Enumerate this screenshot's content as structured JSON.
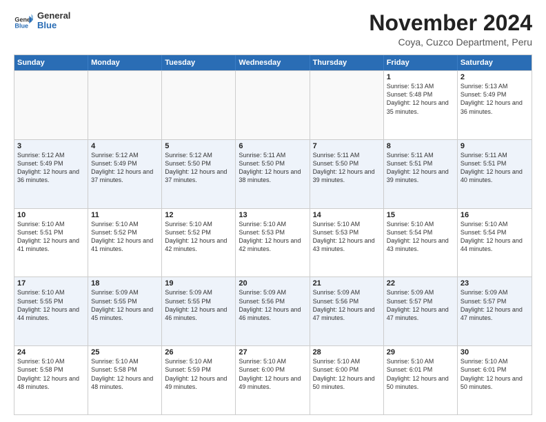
{
  "logo": {
    "general": "General",
    "blue": "Blue"
  },
  "header": {
    "month": "November 2024",
    "location": "Coya, Cuzco Department, Peru"
  },
  "days_of_week": [
    "Sunday",
    "Monday",
    "Tuesday",
    "Wednesday",
    "Thursday",
    "Friday",
    "Saturday"
  ],
  "weeks": [
    [
      {
        "day": "",
        "empty": true
      },
      {
        "day": "",
        "empty": true
      },
      {
        "day": "",
        "empty": true
      },
      {
        "day": "",
        "empty": true
      },
      {
        "day": "",
        "empty": true
      },
      {
        "day": "1",
        "sunrise": "5:13 AM",
        "sunset": "5:48 PM",
        "daylight": "12 hours and 35 minutes."
      },
      {
        "day": "2",
        "sunrise": "5:13 AM",
        "sunset": "5:49 PM",
        "daylight": "12 hours and 36 minutes."
      }
    ],
    [
      {
        "day": "3",
        "sunrise": "5:12 AM",
        "sunset": "5:49 PM",
        "daylight": "12 hours and 36 minutes."
      },
      {
        "day": "4",
        "sunrise": "5:12 AM",
        "sunset": "5:49 PM",
        "daylight": "12 hours and 37 minutes."
      },
      {
        "day": "5",
        "sunrise": "5:12 AM",
        "sunset": "5:50 PM",
        "daylight": "12 hours and 37 minutes."
      },
      {
        "day": "6",
        "sunrise": "5:11 AM",
        "sunset": "5:50 PM",
        "daylight": "12 hours and 38 minutes."
      },
      {
        "day": "7",
        "sunrise": "5:11 AM",
        "sunset": "5:50 PM",
        "daylight": "12 hours and 39 minutes."
      },
      {
        "day": "8",
        "sunrise": "5:11 AM",
        "sunset": "5:51 PM",
        "daylight": "12 hours and 39 minutes."
      },
      {
        "day": "9",
        "sunrise": "5:11 AM",
        "sunset": "5:51 PM",
        "daylight": "12 hours and 40 minutes."
      }
    ],
    [
      {
        "day": "10",
        "sunrise": "5:10 AM",
        "sunset": "5:51 PM",
        "daylight": "12 hours and 41 minutes."
      },
      {
        "day": "11",
        "sunrise": "5:10 AM",
        "sunset": "5:52 PM",
        "daylight": "12 hours and 41 minutes."
      },
      {
        "day": "12",
        "sunrise": "5:10 AM",
        "sunset": "5:52 PM",
        "daylight": "12 hours and 42 minutes."
      },
      {
        "day": "13",
        "sunrise": "5:10 AM",
        "sunset": "5:53 PM",
        "daylight": "12 hours and 42 minutes."
      },
      {
        "day": "14",
        "sunrise": "5:10 AM",
        "sunset": "5:53 PM",
        "daylight": "12 hours and 43 minutes."
      },
      {
        "day": "15",
        "sunrise": "5:10 AM",
        "sunset": "5:54 PM",
        "daylight": "12 hours and 43 minutes."
      },
      {
        "day": "16",
        "sunrise": "5:10 AM",
        "sunset": "5:54 PM",
        "daylight": "12 hours and 44 minutes."
      }
    ],
    [
      {
        "day": "17",
        "sunrise": "5:10 AM",
        "sunset": "5:55 PM",
        "daylight": "12 hours and 44 minutes."
      },
      {
        "day": "18",
        "sunrise": "5:09 AM",
        "sunset": "5:55 PM",
        "daylight": "12 hours and 45 minutes."
      },
      {
        "day": "19",
        "sunrise": "5:09 AM",
        "sunset": "5:55 PM",
        "daylight": "12 hours and 46 minutes."
      },
      {
        "day": "20",
        "sunrise": "5:09 AM",
        "sunset": "5:56 PM",
        "daylight": "12 hours and 46 minutes."
      },
      {
        "day": "21",
        "sunrise": "5:09 AM",
        "sunset": "5:56 PM",
        "daylight": "12 hours and 47 minutes."
      },
      {
        "day": "22",
        "sunrise": "5:09 AM",
        "sunset": "5:57 PM",
        "daylight": "12 hours and 47 minutes."
      },
      {
        "day": "23",
        "sunrise": "5:09 AM",
        "sunset": "5:57 PM",
        "daylight": "12 hours and 47 minutes."
      }
    ],
    [
      {
        "day": "24",
        "sunrise": "5:10 AM",
        "sunset": "5:58 PM",
        "daylight": "12 hours and 48 minutes."
      },
      {
        "day": "25",
        "sunrise": "5:10 AM",
        "sunset": "5:58 PM",
        "daylight": "12 hours and 48 minutes."
      },
      {
        "day": "26",
        "sunrise": "5:10 AM",
        "sunset": "5:59 PM",
        "daylight": "12 hours and 49 minutes."
      },
      {
        "day": "27",
        "sunrise": "5:10 AM",
        "sunset": "6:00 PM",
        "daylight": "12 hours and 49 minutes."
      },
      {
        "day": "28",
        "sunrise": "5:10 AM",
        "sunset": "6:00 PM",
        "daylight": "12 hours and 50 minutes."
      },
      {
        "day": "29",
        "sunrise": "5:10 AM",
        "sunset": "6:01 PM",
        "daylight": "12 hours and 50 minutes."
      },
      {
        "day": "30",
        "sunrise": "5:10 AM",
        "sunset": "6:01 PM",
        "daylight": "12 hours and 50 minutes."
      }
    ]
  ]
}
